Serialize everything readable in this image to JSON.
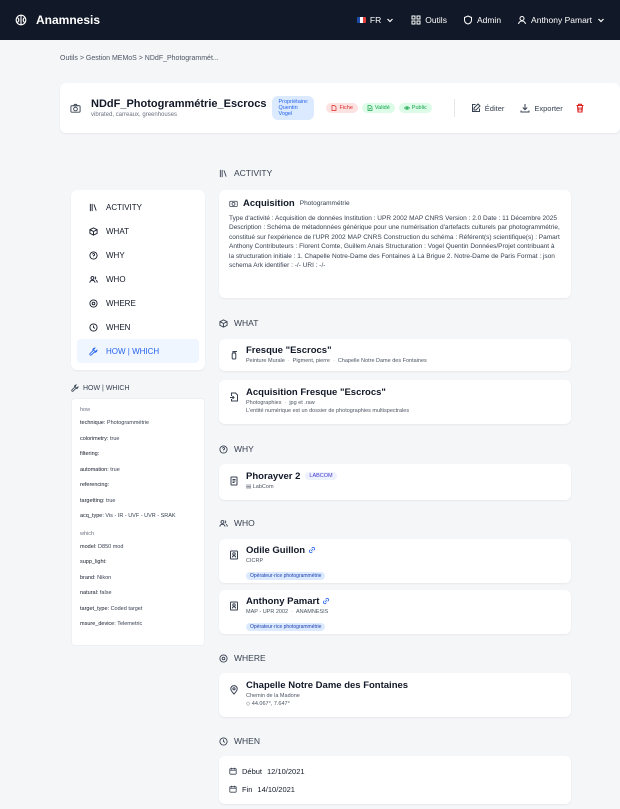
{
  "nav": {
    "brand": "Anamnesis",
    "lang": "FR",
    "tools": "Outils",
    "admin": "Admin",
    "user": "Anthony Pamart"
  },
  "breadcrumb": "Outils > Gestion MEMoS > NDdF_Photogrammét...",
  "header": {
    "title": "NDdF_Photogrammétrie_Escrocs",
    "subtitle": "vibrated, carreaux, greenhouses",
    "owner_label": "Propriétaire:",
    "owner_name": "Quentin Vogel",
    "badges": [
      "Fiche",
      "Validé",
      "Public"
    ],
    "edit": "Éditer",
    "export": "Exporter"
  },
  "sidebar": {
    "items": [
      {
        "label": "ACTIVITY",
        "icon": "library-icon"
      },
      {
        "label": "WHAT",
        "icon": "cube-icon"
      },
      {
        "label": "WHY",
        "icon": "help-circle-icon"
      },
      {
        "label": "WHO",
        "icon": "users-icon"
      },
      {
        "label": "WHERE",
        "icon": "map-pin-icon"
      },
      {
        "label": "WHEN",
        "icon": "clock-icon"
      },
      {
        "label": "HOW | WHICH",
        "icon": "wrench-icon"
      }
    ]
  },
  "props": {
    "title": "HOW | WHICH",
    "how_label": "how",
    "how": [
      {
        "k": "technique:",
        "v": "Photogrammétrie"
      },
      {
        "k": "colorimetry:",
        "v": "true"
      },
      {
        "k": "filtering:",
        "v": ""
      },
      {
        "k": "automation:",
        "v": "true"
      },
      {
        "k": "referencing:",
        "v": ""
      },
      {
        "k": "targetting:",
        "v": "true"
      },
      {
        "k": "acq_type:",
        "v": "Vis - IR - UVF - UVR - SRAK"
      }
    ],
    "which_label": "which",
    "which": [
      {
        "k": "model:",
        "v": "D850 mod"
      },
      {
        "k": "supp_light:",
        "v": ""
      },
      {
        "k": "brand:",
        "v": "Nikon"
      },
      {
        "k": "natural:",
        "v": "false"
      },
      {
        "k": "target_type:",
        "v": "Coded target"
      },
      {
        "k": "msure_device:",
        "v": "Telemetric"
      }
    ]
  },
  "sections": {
    "activity": "ACTIVITY",
    "what": "WHAT",
    "why": "WHY",
    "who": "WHO",
    "where": "WHERE",
    "when": "WHEN"
  },
  "activity": {
    "title": "Acquisition",
    "type": "Photogrammétrie",
    "description": "Type d'activité : Acquisition de données Institution : UPR 2002 MAP CNRS Version : 2.0 Date : 11 Décembre 2025 Description : Schéma de métadonnées générique pour une numérisation d'artefacts culturels par photogrammétrie, constitué sur l'expérience de l'UPR 2002 MAP CNRS Construction du schéma : Référent(s) scientifique(s) : Pamart Anthony Contributeurs : Florent Comte, Guillem Anais Structuration : Vogel Quentin Données/Projet contribuant à la structuration initiale : 1. Chapelle Notre-Dame des Fontaines à La Brigue 2. Notre-Dame de Paris Format : json schema Ark identifier : -/- URI : -/-"
  },
  "what": [
    {
      "title": "Fresque \"Escrocs\"",
      "meta": [
        "Peinture Murale",
        "Pigment, pierre",
        "Chapelle Notre Dame des Fontaines"
      ]
    },
    {
      "title": "Acquisition Fresque \"Escrocs\"",
      "meta": [
        "Photographies",
        "jpg et .raw"
      ],
      "desc": "L'entité numérique est un dossier de photographies multispectrales"
    }
  ],
  "why": {
    "title": "Phorayver 2",
    "tag": "LABCOM",
    "sub": "LabCom"
  },
  "who": [
    {
      "name": "Odile Guillon",
      "org": [
        "CICRP"
      ],
      "role": "Opérateur·rice photogrammétrie"
    },
    {
      "name": "Anthony Pamart",
      "org": [
        "MAP - UPR 2002",
        "ANAMNESIS"
      ],
      "role": "Opérateur·rice photogrammétrie"
    }
  ],
  "where": {
    "title": "Chapelle Notre Dame des Fontaines",
    "address": "Chemin de la Madone",
    "coords": "44.067°, 7.647°"
  },
  "when": {
    "start_label": "Début",
    "start": "12/10/2021",
    "end_label": "Fin",
    "end": "14/10/2021"
  }
}
